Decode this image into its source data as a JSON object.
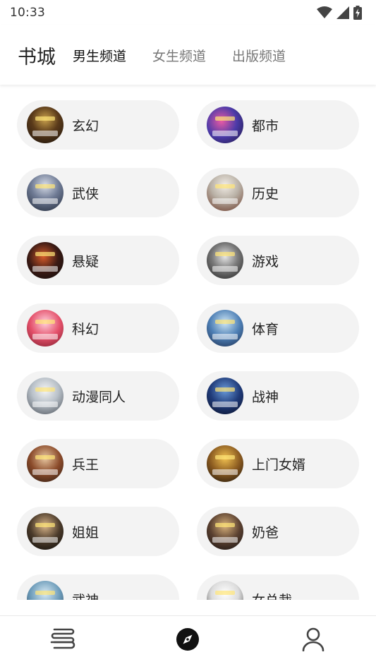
{
  "status_bar": {
    "time": "10:33",
    "icons": [
      "wifi-icon",
      "cellular-signal-icon",
      "battery-charging-icon"
    ]
  },
  "header": {
    "title": "书城",
    "tabs": [
      {
        "label": "男生频道",
        "active": true
      },
      {
        "label": "女生频道",
        "active": false
      },
      {
        "label": "出版频道",
        "active": false
      }
    ]
  },
  "categories": [
    {
      "label": "玄幻"
    },
    {
      "label": "都市"
    },
    {
      "label": "武侠"
    },
    {
      "label": "历史"
    },
    {
      "label": "悬疑"
    },
    {
      "label": "游戏"
    },
    {
      "label": "科幻"
    },
    {
      "label": "体育"
    },
    {
      "label": "动漫同人"
    },
    {
      "label": "战神"
    },
    {
      "label": "兵王"
    },
    {
      "label": "上门女婿"
    },
    {
      "label": "姐姐"
    },
    {
      "label": "奶爸"
    },
    {
      "label": "武神"
    },
    {
      "label": "女总裁"
    }
  ],
  "bottom_nav": {
    "items": [
      {
        "icon": "bookshelf-icon",
        "active": false
      },
      {
        "icon": "compass-icon",
        "active": true
      },
      {
        "icon": "profile-icon",
        "active": false
      }
    ]
  },
  "colors": {
    "active_text": "#111111",
    "inactive_text": "#777777",
    "pill_background": "#f3f3f3"
  }
}
